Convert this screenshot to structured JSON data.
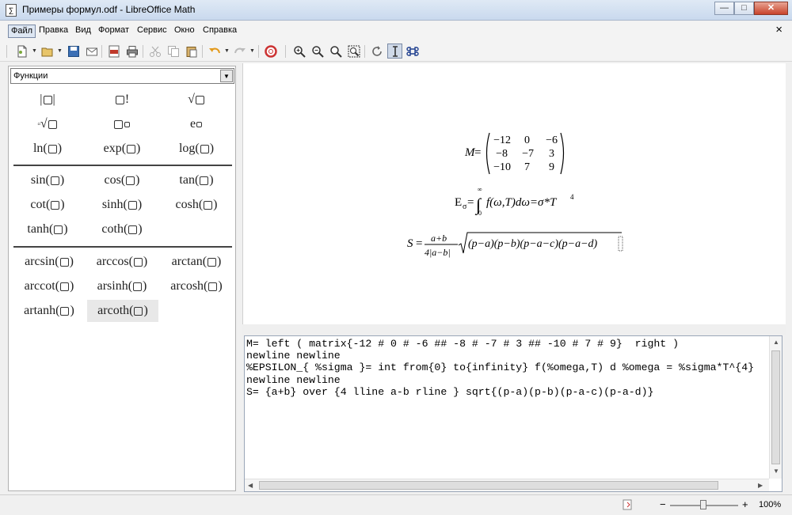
{
  "window": {
    "title": "Примеры формул.odf - LibreOffice Math",
    "minimize": "—",
    "maximize": "□",
    "close": "✕"
  },
  "menu": {
    "items": [
      "Файл",
      "Правка",
      "Вид",
      "Формат",
      "Сервис",
      "Окно",
      "Справка"
    ],
    "active": "Файл",
    "doc_close": "×"
  },
  "toolbar": {
    "buttons": [
      "new-document-icon",
      "open-icon",
      "save-icon",
      "email-icon",
      "export-pdf-icon",
      "print-icon",
      "cut-icon",
      "copy-icon",
      "paste-icon",
      "undo-icon",
      "redo-icon",
      "help-icon",
      "zoom-in-icon",
      "zoom-out-icon",
      "zoom-100-icon",
      "show-all-icon",
      "update-icon",
      "formula-cursor-icon",
      "symbols-icon"
    ]
  },
  "elements_panel": {
    "dropdown_value": "Функции",
    "dropdown_arrow": "▼",
    "group1": [
      {
        "pre": "|",
        "post": "|"
      },
      {
        "pre": "",
        "post": "!"
      },
      {
        "pre": "√",
        "post": ""
      },
      {
        "pre": "ⁿ√",
        "post": ""
      },
      {
        "pre": "",
        "post": "sup"
      },
      {
        "pre": "e",
        "post": "sup"
      }
    ],
    "group1_named": [
      "ln",
      "exp",
      "log"
    ],
    "group2": [
      "sin",
      "cos",
      "tan",
      "cot",
      "sinh",
      "cosh",
      "tanh",
      "coth"
    ],
    "group3": [
      "arcsin",
      "arccos",
      "arctan",
      "arccot",
      "arsinh",
      "arcosh",
      "artanh",
      "arcoth"
    ],
    "highlighted": "arcoth"
  },
  "formula": {
    "m_label": "M",
    "matrix": [
      [
        "−12",
        "0",
        "−6"
      ],
      [
        "−8",
        "−7",
        "3"
      ],
      [
        "−10",
        "7",
        "9"
      ]
    ],
    "e_label": "E",
    "e_sub": "σ",
    "int_upper": "∞",
    "int_lower": "0",
    "e_body": "f(ω,T)dω=σ*T",
    "e_sup": "4",
    "s_label": "S",
    "s_num": "a+b",
    "s_den": "4|a−b|",
    "s_sqrt": "(p−a)(p−b)(p−a−c)(p−a−d)"
  },
  "editor": {
    "lines": [
      "M= left ( matrix{-12 # 0 # -6 ## -8 # -7 # 3 ## -10 # 7 # 9}  right )",
      "newline newline",
      "%EPSILON_{ %sigma }= int from{0} to{infinity} f(%omega,T) d %omega = %sigma*T^{4}",
      "newline newline",
      "S= {a+b} over {4 lline a-b rline } sqrt{(p-a)(p-b)(p-a-c)(p-a-d)}"
    ]
  },
  "status": {
    "zoom_minus": "−",
    "zoom_plus": "+",
    "zoom_level": "100%",
    "doc_modified_icon": "document-modified-icon"
  }
}
